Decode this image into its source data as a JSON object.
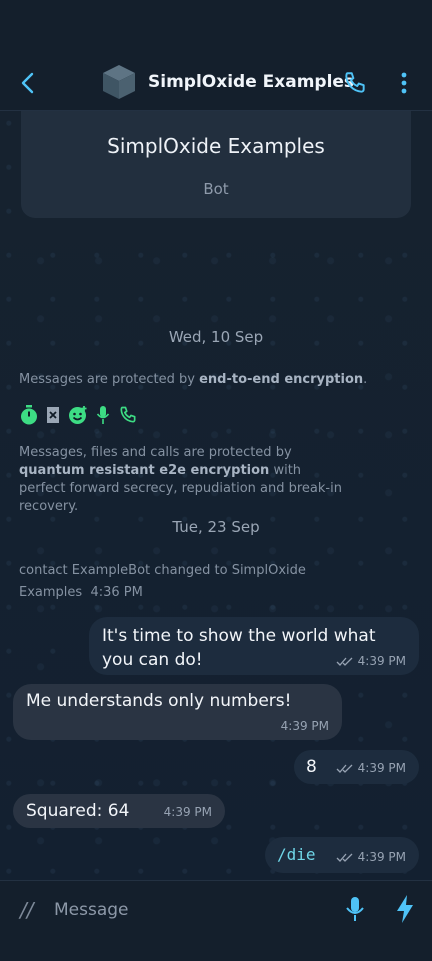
{
  "header": {
    "title": "SimplOxide Examples",
    "icons": {
      "back": "chevron-left-icon",
      "avatar": "cube-icon",
      "call": "phone-icon",
      "menu": "vertical-dots-icon"
    }
  },
  "profile": {
    "name": "SimplOxide Examples",
    "role": "Bot"
  },
  "feed": {
    "date1": "Wed, 10 Sep",
    "encryption": {
      "prefix": "Messages are protected by ",
      "bold": "end-to-end encryption",
      "suffix": "."
    },
    "feature_icons": [
      "timer-icon",
      "delete-icon",
      "emoji-add-icon",
      "microphone-icon",
      "phone-icon"
    ],
    "quantum": {
      "prefix": "Messages, files and calls are protected by ",
      "bold": "quantum resistant e2e encryption",
      "suffix": " with perfect forward secrecy, repudiation and break-in recovery."
    },
    "date2": "Tue, 23 Sep",
    "contact_change": {
      "text_line1": "contact ExampleBot changed to SimplOxide",
      "text_line2": "Examples",
      "time": "4:36 PM"
    },
    "messages": [
      {
        "direction": "out",
        "text": "It's time to show the world what you can do!",
        "time": "4:39 PM"
      },
      {
        "direction": "in",
        "text": "Me understands only numbers!",
        "time": "4:39 PM"
      },
      {
        "direction": "out",
        "text": "8",
        "time": "4:39 PM"
      },
      {
        "direction": "in",
        "text": "Squared: 64",
        "time": "4:39 PM"
      },
      {
        "direction": "out",
        "text": "/die",
        "time": "4:39 PM"
      }
    ]
  },
  "composer": {
    "placeholder": "Message",
    "slash": "//"
  },
  "colors": {
    "accent": "#4fc3f7",
    "green": "#3ddc84",
    "bg": "#0f1a26"
  }
}
